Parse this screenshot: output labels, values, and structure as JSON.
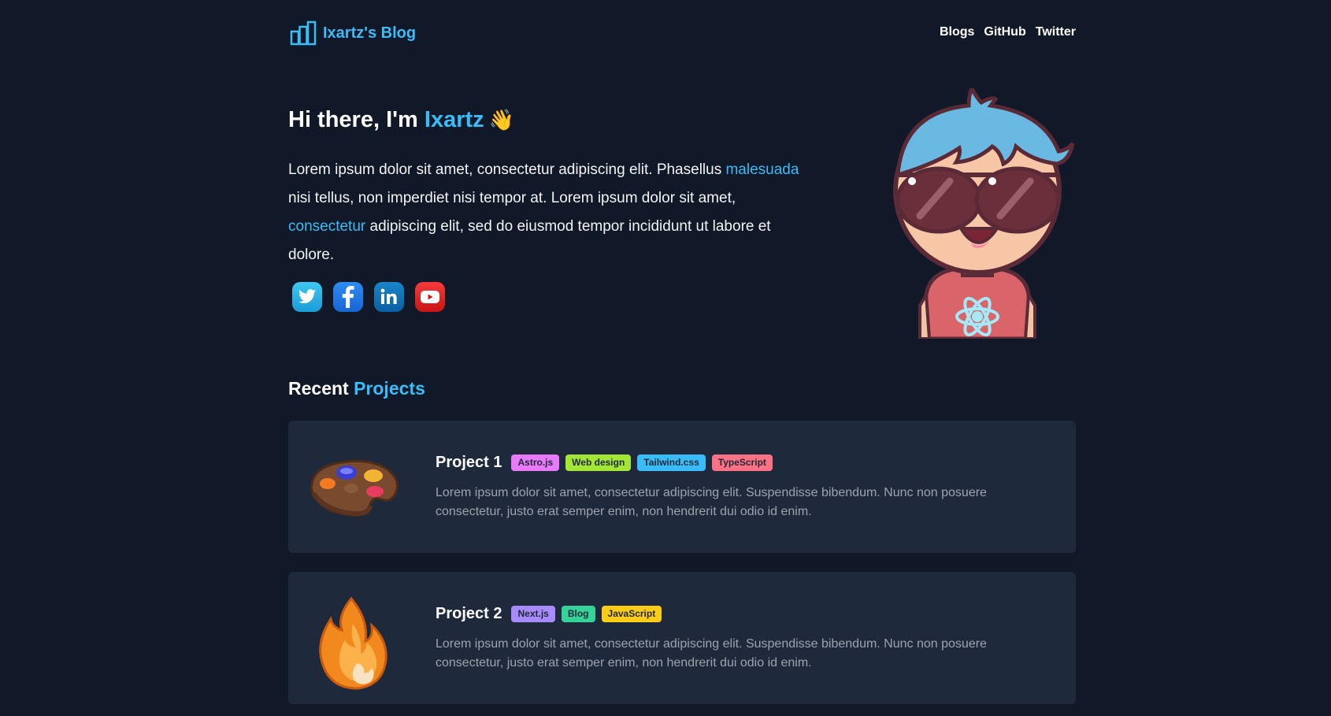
{
  "header": {
    "logo_text": "Ixartz's Blog",
    "nav": [
      "Blogs",
      "GitHub",
      "Twitter"
    ]
  },
  "hero": {
    "title_prefix": "Hi there, I'm ",
    "title_name": "Ixartz",
    "wave": "👋",
    "text_1": "Lorem ipsum dolor sit amet, consectetur adipiscing elit. Phasellus ",
    "link_1": "malesuada",
    "text_2": " nisi tellus, non imperdiet nisi tempor at. Lorem ipsum dolor sit amet, ",
    "link_2": "consectetur",
    "text_3": " adipiscing elit, sed do eiusmod tempor incididunt ut labore et dolore.",
    "socials": [
      "twitter-icon",
      "facebook-icon",
      "linkedin-icon",
      "youtube-icon"
    ]
  },
  "projects": {
    "title_prefix": "Recent ",
    "title_accent": "Projects",
    "items": [
      {
        "title": "Project 1",
        "icon": "paint-palette-icon",
        "tags": [
          {
            "label": "Astro.js",
            "color": "#e879f9"
          },
          {
            "label": "Web design",
            "color": "#a3e635"
          },
          {
            "label": "Tailwind.css",
            "color": "#38bdf8"
          },
          {
            "label": "TypeScript",
            "color": "#fb7185"
          }
        ],
        "description": "Lorem ipsum dolor sit amet, consectetur adipiscing elit. Suspendisse bibendum. Nunc non posuere consectetur, justo erat semper enim, non hendrerit dui odio id enim."
      },
      {
        "title": "Project 2",
        "icon": "fire-icon",
        "tags": [
          {
            "label": "Next.js",
            "color": "#a78bfa"
          },
          {
            "label": "Blog",
            "color": "#34d399"
          },
          {
            "label": "JavaScript",
            "color": "#facc15"
          }
        ],
        "description": "Lorem ipsum dolor sit amet, consectetur adipiscing elit. Suspendisse bibendum. Nunc non posuere consectetur, justo erat semper enim, non hendrerit dui odio id enim."
      }
    ]
  },
  "colors": {
    "background": "#111827",
    "card": "#1e293b",
    "accent": "#38bdf8"
  }
}
